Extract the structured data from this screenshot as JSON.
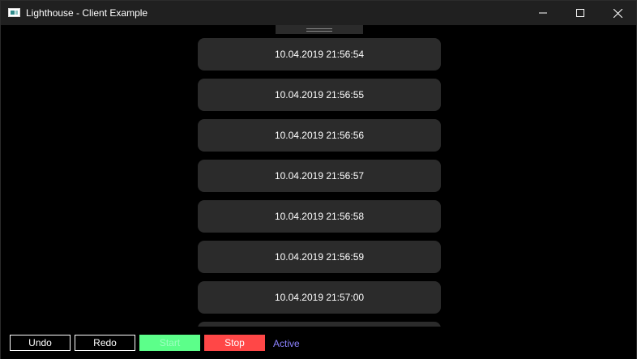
{
  "window": {
    "title": "Lighthouse - Client Example",
    "icon": "app-window-icon"
  },
  "titlebar_controls": {
    "minimize_icon": "minimize-icon",
    "maximize_icon": "maximize-icon",
    "close_icon": "close-icon"
  },
  "list": {
    "items": [
      {
        "label": "10.04.2019 21:56:54"
      },
      {
        "label": "10.04.2019 21:56:55"
      },
      {
        "label": "10.04.2019 21:56:56"
      },
      {
        "label": "10.04.2019 21:56:57"
      },
      {
        "label": "10.04.2019 21:56:58"
      },
      {
        "label": "10.04.2019 21:56:59"
      },
      {
        "label": "10.04.2019 21:57:00"
      },
      {
        "label": ""
      }
    ]
  },
  "toolbar": {
    "undo_label": "Undo",
    "redo_label": "Redo",
    "start_label": "Start",
    "stop_label": "Stop",
    "status_label": "Active"
  },
  "colors": {
    "background": "#000000",
    "item_background": "#2b2b2b",
    "start_button": "#5cff8a",
    "stop_button": "#ff4747",
    "status_text": "#8c82ff"
  }
}
